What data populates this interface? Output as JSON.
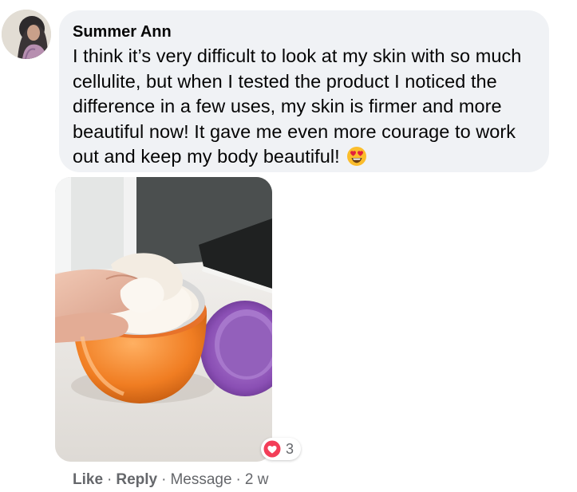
{
  "comment": {
    "author": "Summer Ann",
    "text": "I think it’s very difficult to look at my skin with so much cellulite, but when I tested the product I noticed the difference in a few uses, my skin is firmer and more beautiful now! It gave me even more courage to work out and keep my body beautiful!",
    "emoji": "smiling-face-with-heart-eyes-icon"
  },
  "reactions": {
    "icon": "love-heart-icon",
    "count": "3",
    "color": "#f33e58"
  },
  "actions": {
    "like": "Like",
    "reply": "Reply",
    "message": "Message",
    "time": "2 w",
    "separator": "·"
  },
  "colors": {
    "bubble": "#f0f2f5",
    "text": "#050505",
    "secondary_text": "#65676b"
  }
}
